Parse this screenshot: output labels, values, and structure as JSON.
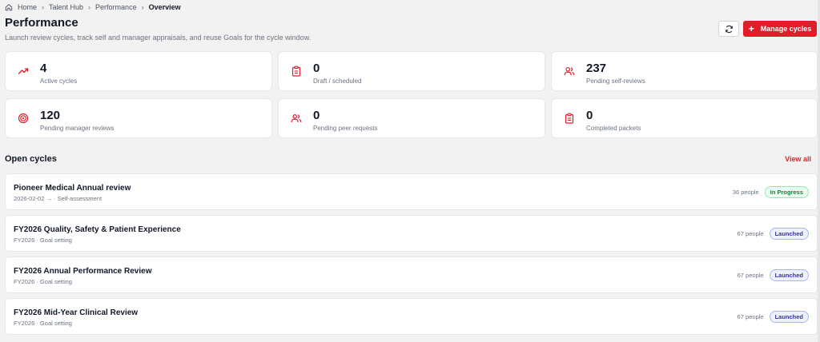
{
  "breadcrumb": {
    "items": [
      "Home",
      "Talent Hub",
      "Performance"
    ],
    "current": "Overview"
  },
  "header": {
    "title": "Performance",
    "subtitle": "Launch review cycles, track self and manager appraisals, and reuse Goals for the cycle window.",
    "manage_label": "Manage cycles"
  },
  "stats": [
    {
      "value": "4",
      "label": "Active cycles",
      "icon": "trending-up-icon"
    },
    {
      "value": "0",
      "label": "Draft / scheduled",
      "icon": "clipboard-icon"
    },
    {
      "value": "237",
      "label": "Pending self-reviews",
      "icon": "users-icon"
    },
    {
      "value": "120",
      "label": "Pending manager reviews",
      "icon": "target-icon"
    },
    {
      "value": "0",
      "label": "Pending peer requests",
      "icon": "users-icon"
    },
    {
      "value": "0",
      "label": "Completed packets",
      "icon": "clipboard-icon"
    }
  ],
  "open_cycles": {
    "title": "Open cycles",
    "view_all": "View all",
    "items": [
      {
        "name": "Pioneer Medical Annual review",
        "meta": "2026-02-02 → · Self-assessment",
        "count": "36 people",
        "status": "In Progress"
      },
      {
        "name": "FY2026 Quality, Safety & Patient Experience",
        "meta": "FY2026 · Goal setting",
        "count": "67 people",
        "status": "Launched"
      },
      {
        "name": "FY2026 Annual Performance Review",
        "meta": "FY2026 · Goal setting",
        "count": "67 people",
        "status": "Launched"
      },
      {
        "name": "FY2026 Mid-Year Clinical Review",
        "meta": "FY2026 · Goal setting",
        "count": "67 people",
        "status": "Launched"
      }
    ]
  },
  "colors": {
    "accent": "#e11d2a",
    "in_progress": "#15803d",
    "launched": "#3730a3"
  }
}
